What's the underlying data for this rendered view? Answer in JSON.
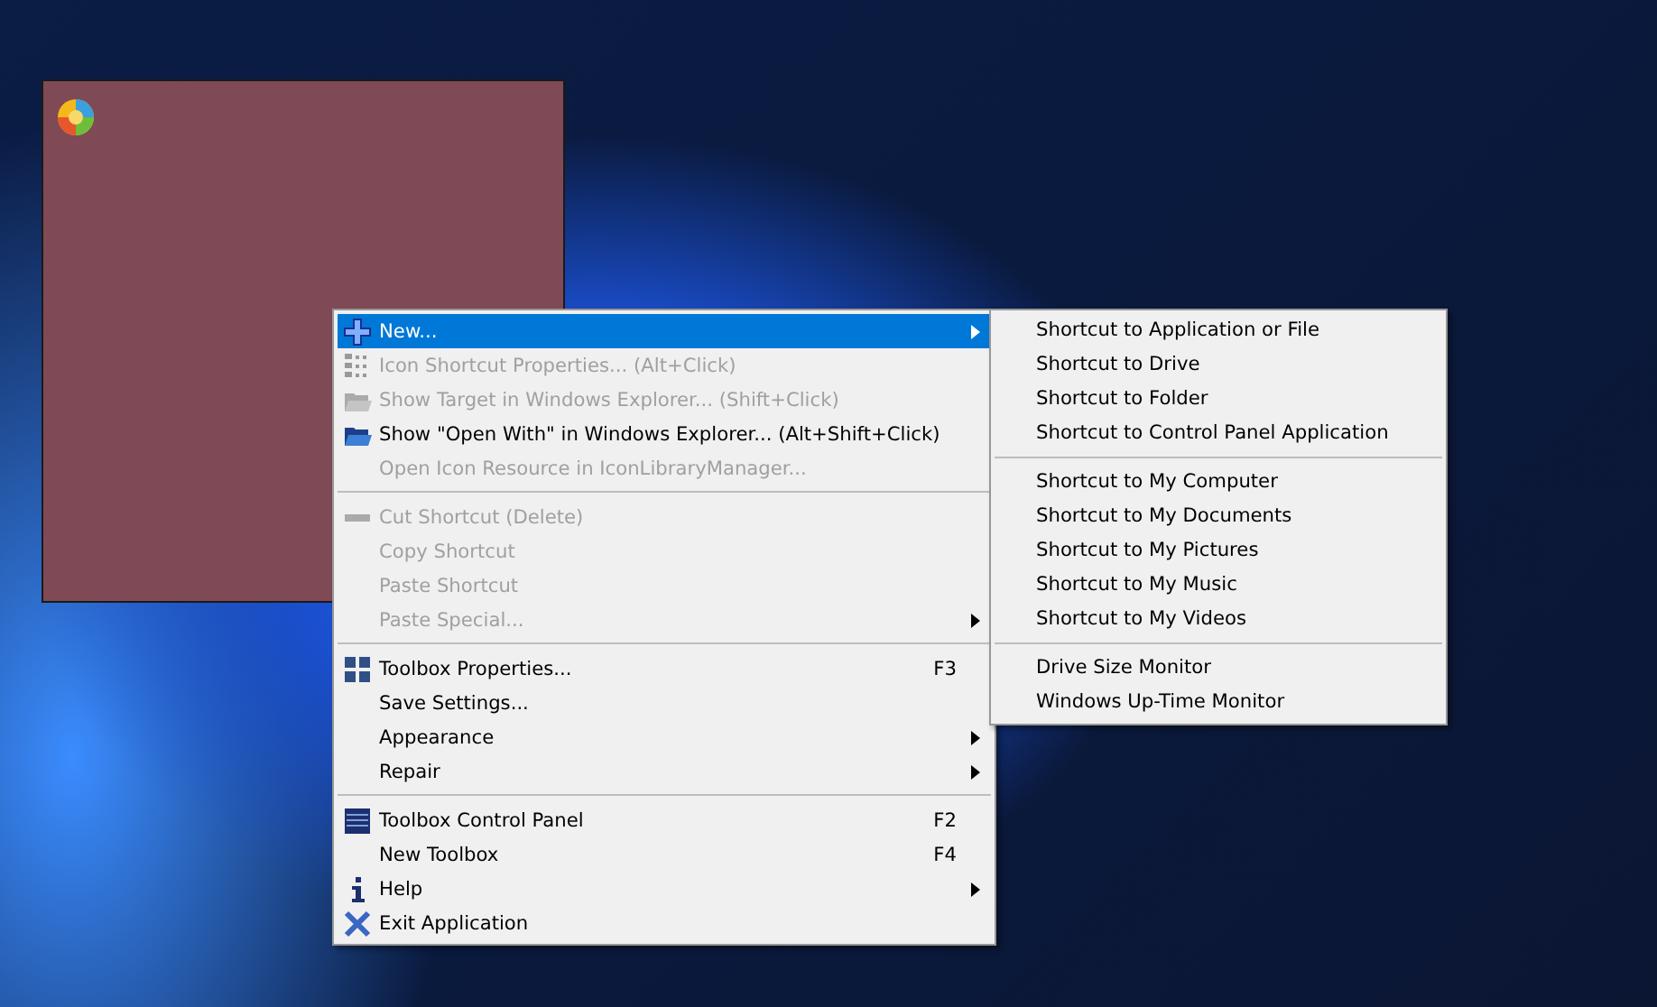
{
  "menu": {
    "items": [
      {
        "kind": "item",
        "label": "New...",
        "selected": true,
        "disabled": false,
        "submenu": true
      },
      {
        "kind": "item",
        "label": "Icon Shortcut Properties... (Alt+Click)",
        "selected": false,
        "disabled": true,
        "submenu": false
      },
      {
        "kind": "item",
        "label": "Show Target in Windows Explorer... (Shift+Click)",
        "selected": false,
        "disabled": true,
        "submenu": false
      },
      {
        "kind": "item",
        "label": "Show \"Open With\" in Windows Explorer... (Alt+Shift+Click)",
        "selected": false,
        "disabled": false,
        "submenu": false
      },
      {
        "kind": "item",
        "label": "Open Icon Resource in IconLibraryManager...",
        "selected": false,
        "disabled": true,
        "submenu": false
      },
      {
        "kind": "separator"
      },
      {
        "kind": "item",
        "label": "Cut Shortcut (Delete)",
        "selected": false,
        "disabled": true,
        "submenu": false
      },
      {
        "kind": "item",
        "label": "Copy Shortcut",
        "selected": false,
        "disabled": true,
        "submenu": false
      },
      {
        "kind": "item",
        "label": "Paste Shortcut",
        "selected": false,
        "disabled": true,
        "submenu": false
      },
      {
        "kind": "item",
        "label": "Paste Special...",
        "selected": false,
        "disabled": true,
        "submenu": true
      },
      {
        "kind": "separator"
      },
      {
        "kind": "item",
        "label": "Toolbox Properties...",
        "shortcut": "F3",
        "selected": false,
        "disabled": false,
        "submenu": false
      },
      {
        "kind": "item",
        "label": "Save Settings...",
        "selected": false,
        "disabled": false,
        "submenu": false
      },
      {
        "kind": "item",
        "label": "Appearance",
        "selected": false,
        "disabled": false,
        "submenu": true
      },
      {
        "kind": "item",
        "label": "Repair",
        "selected": false,
        "disabled": false,
        "submenu": true
      },
      {
        "kind": "separator"
      },
      {
        "kind": "item",
        "label": "Toolbox Control Panel",
        "shortcut": "F2",
        "selected": false,
        "disabled": false,
        "submenu": false
      },
      {
        "kind": "item",
        "label": "New Toolbox",
        "shortcut": "F4",
        "selected": false,
        "disabled": false,
        "submenu": false
      },
      {
        "kind": "item",
        "label": "Help",
        "selected": false,
        "disabled": false,
        "submenu": true
      },
      {
        "kind": "item",
        "label": "Exit Application",
        "selected": false,
        "disabled": false,
        "submenu": false
      }
    ]
  },
  "submenu": {
    "items": [
      {
        "kind": "item",
        "label": "Shortcut to Application or File"
      },
      {
        "kind": "item",
        "label": "Shortcut to Drive"
      },
      {
        "kind": "item",
        "label": "Shortcut to Folder"
      },
      {
        "kind": "item",
        "label": "Shortcut to Control Panel Application"
      },
      {
        "kind": "separator"
      },
      {
        "kind": "item",
        "label": "Shortcut to My Computer"
      },
      {
        "kind": "item",
        "label": "Shortcut to My Documents"
      },
      {
        "kind": "item",
        "label": "Shortcut to My Pictures"
      },
      {
        "kind": "item",
        "label": "Shortcut to My Music"
      },
      {
        "kind": "item",
        "label": "Shortcut to My Videos"
      },
      {
        "kind": "separator"
      },
      {
        "kind": "item",
        "label": "Drive Size Monitor"
      },
      {
        "kind": "item",
        "label": "Windows Up-Time Monitor"
      }
    ]
  }
}
